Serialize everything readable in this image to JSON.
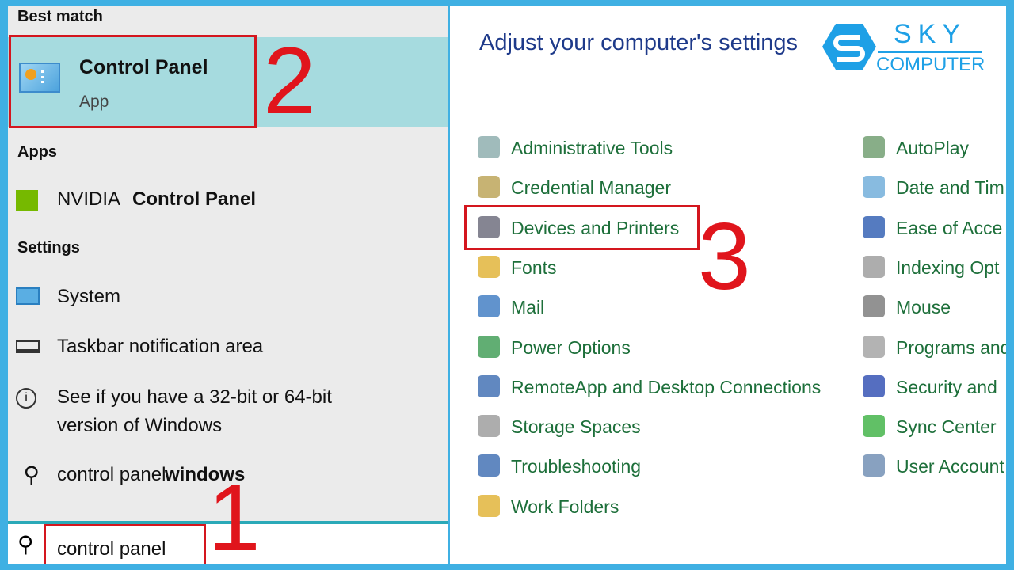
{
  "search_panel": {
    "best_match_header": "Best match",
    "best_match": {
      "title": "Control Panel",
      "subtitle": "App",
      "icon": "control-panel-icon"
    },
    "apps_header": "Apps",
    "apps": [
      {
        "prefix": "NVIDIA ",
        "bold": "Control Panel",
        "icon": "nvidia-icon"
      }
    ],
    "settings_header": "Settings",
    "settings": [
      {
        "label": "System",
        "icon": "monitor-icon"
      },
      {
        "label": "Taskbar notification area",
        "icon": "taskbar-icon"
      },
      {
        "label": "See if you have a 32-bit or 64-bit",
        "label2": "version of Windows",
        "icon": "info-icon"
      }
    ],
    "web_suggestion": {
      "prefix": "control panel ",
      "bold": "windows",
      "icon": "search-icon"
    },
    "search_input": {
      "value": "control panel",
      "icon": "search-icon"
    }
  },
  "control_panel": {
    "title": "Adjust your computer's settings",
    "col1": [
      "Administrative Tools",
      "Credential Manager",
      "Devices and Printers",
      "Fonts",
      "Mail",
      "Power Options",
      "RemoteApp and Desktop Connections",
      "Storage Spaces",
      "Troubleshooting",
      "Work Folders"
    ],
    "col2": [
      "AutoPlay",
      "Date and Tim",
      "Ease of Acce",
      "Indexing Opt",
      "Mouse",
      "Programs and",
      "Security and",
      "Sync Center",
      "User Account"
    ]
  },
  "annotations": {
    "step1": "1",
    "step2": "2",
    "step3": "3"
  },
  "logo": {
    "line1": "SKY",
    "line2": "COMPUTER"
  },
  "colors": {
    "border": "#3fb0e3",
    "highlight": "#a6dbdf",
    "annotation": "#e0151c",
    "link": "#1d6f3a",
    "title": "#1e3a8a"
  }
}
